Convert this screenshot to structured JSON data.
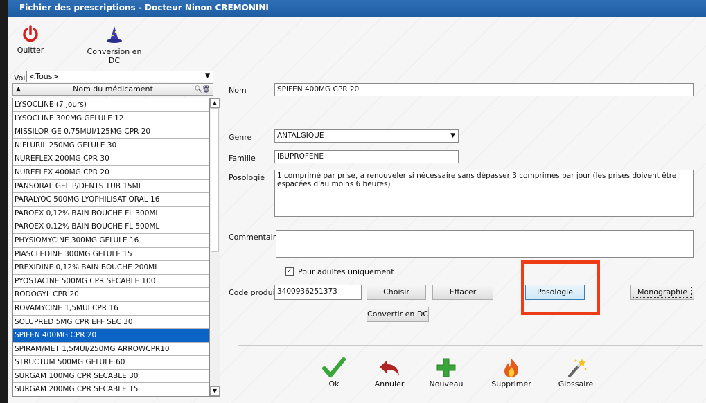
{
  "window": {
    "title": "Fichier des prescriptions - Docteur Ninon CREMONINI"
  },
  "toolbar": {
    "quit_label": "Quitter",
    "convert_label": "Conversion en DC"
  },
  "filter": {
    "label": "Voir",
    "value": "<Tous>"
  },
  "list": {
    "header": "Nom du médicament",
    "items": [
      "LYSOCLINE (7 jours)",
      "LYSOCLINE 300MG GELULE 12",
      "MISSILOR GE 0,75MUI/125MG CPR 20",
      "NIFLURIL 250MG GELULE 30",
      "NUREFLEX 200MG CPR 30",
      "NUREFLEX 400MG CPR 20",
      "PANSORAL GEL P/DENTS TUB 15ML",
      "PARALYOC 500MG LYOPHILISAT ORAL 16",
      "PAROEX 0,12% BAIN BOUCHE FL 300ML",
      "PAROEX 0,12% BAIN BOUCHE FL 500ML",
      "PHYSIOMYCINE 300MG GELULE 16",
      "PIASCLEDINE 300MG GELULE 15",
      "PREXIDINE 0,12% BAIN BOUCHE 200ML",
      "PYOSTACINE 500MG CPR SECABLE 100",
      "RODOGYL CPR 20",
      "ROVAMYCINE 1,5MUI CPR 16",
      "SOLUPRED 5MG CPR EFF SEC 30",
      "SPIFEN 400MG CPR 20",
      "SPIRAM/MET 1,5MUI/250MG ARROWCPR10",
      "STRUCTUM 500MG GELULE 60",
      "SURGAM 100MG CPR SECABLE 30",
      "SURGAM 200MG CPR SECABLE 15"
    ],
    "selected": "SPIFEN 400MG CPR 20"
  },
  "form": {
    "nom_label": "Nom",
    "nom_value": "SPIFEN 400MG CPR 20",
    "genre_label": "Genre",
    "genre_value": "ANTALGIQUE",
    "famille_label": "Famille",
    "famille_value": "IBUPROFENE",
    "posologie_label": "Posologie",
    "posologie_value": "1 comprimé par prise, à renouveler si nécessaire sans dépasser 3 comprimés par jour (les prises doivent être espacées d'au moins 6 heures)",
    "commentaire_label": "Commentaire",
    "commentaire_value": "",
    "adult_only_label": "Pour adultes uniquement",
    "adult_only_checked": true,
    "code_label": "Code produit",
    "code_value": "3400936251373",
    "choisir_label": "Choisir",
    "effacer_label": "Effacer",
    "posologie_button": "Posologie",
    "monographie_button": "Monographie",
    "convertir_button": "Convertir en DC"
  },
  "actions": {
    "ok": "Ok",
    "annuler": "Annuler",
    "nouveau": "Nouveau",
    "supprimer": "Supprimer",
    "glossaire": "Glossaire"
  },
  "colors": {
    "titlebar": "#1f5ea3",
    "selection": "#0a63c5",
    "highlight": "#ee3c17",
    "ok_green": "#3aa63a"
  }
}
